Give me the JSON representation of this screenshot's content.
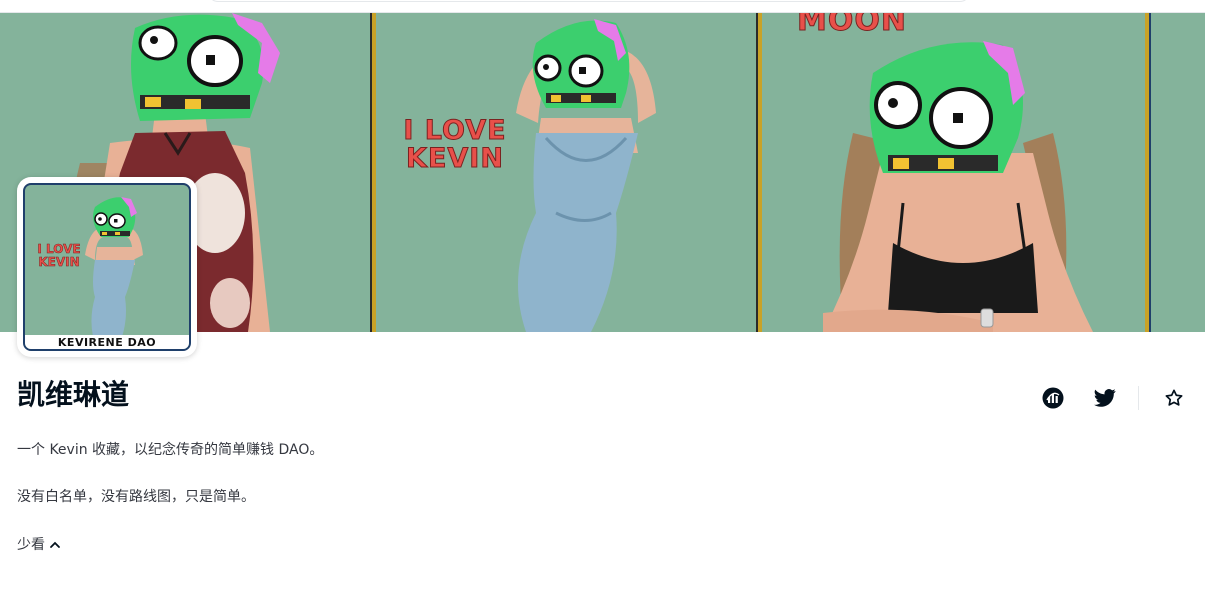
{
  "banner": {
    "panel2_text_line1": "I LOVE",
    "panel2_text_line2": "KEVIN",
    "panel3_text": "MOON"
  },
  "avatar": {
    "text_line1": "I LOVE",
    "text_line2": "KEVIN",
    "label": "KEVIRENE DAO"
  },
  "collection": {
    "title": "凯维琳道",
    "description_line1": "一个 Kevin 收藏，以纪念传奇的简单赚钱 DAO。",
    "description_line2": "没有白名单，没有路线图，只是简单。",
    "toggle_label": "少看"
  },
  "actions": {
    "icons": [
      "activity-chart-icon",
      "twitter-icon",
      "star-icon"
    ]
  },
  "colors": {
    "banner_bg": "#84b39b",
    "poster_text": "#e8504a",
    "zombie_green": "#3ccf6e",
    "zombie_pink": "#e57be8",
    "frame_gold": "#c9a227",
    "frame_navy": "#1f3f6b",
    "text_primary": "#04111d",
    "text_secondary": "#353840"
  }
}
